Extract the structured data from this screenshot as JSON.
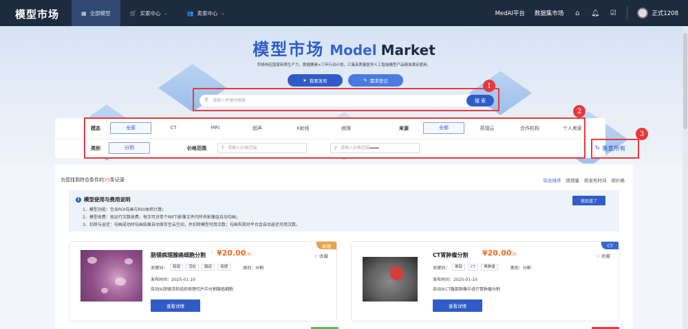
{
  "topbar": {
    "logo": "模型市场",
    "nav": [
      {
        "icon": "grid-icon",
        "label": "全部模型",
        "active": true
      },
      {
        "icon": "cart-icon",
        "label": "买家中心",
        "dropdown": true
      },
      {
        "icon": "user-icon",
        "label": "卖家中心",
        "dropdown": true
      }
    ],
    "links": [
      "MedAI平台",
      "数据集市场"
    ],
    "icons": [
      "home-icon",
      "bell-icon",
      "edit-icon"
    ],
    "username": "正式1208"
  },
  "hero": {
    "title_cn": "模型市场",
    "title_en1": "Model",
    "title_en2": "Market",
    "subtitle": "积极响应国家新质生产力、数据要素×三年行动计划，汇集高质量医学人工智能模型产品精准满足使用。",
    "publish_btn": "我要发布",
    "demand_btn": "需求登记"
  },
  "search": {
    "placeholder": "请输入关键词搜索",
    "button": "搜 索"
  },
  "annotations": [
    "1",
    "2",
    "3"
  ],
  "filters": {
    "modality_label": "模态",
    "modality_options": [
      "全部",
      "CT",
      "MRI",
      "超声",
      "X射线",
      "病理"
    ],
    "modality_selected": "全部",
    "source_label": "来源",
    "source_options": [
      "全部",
      "英瑞云",
      "合作机构",
      "个人卖家"
    ],
    "category_label": "类别",
    "category_selected": "分割",
    "price_label": "价格范围",
    "price_min_placeholder": "请输入价格范围",
    "price_max_placeholder": "请输入价格范围",
    "reset": "重置所有"
  },
  "results": {
    "prefix": "为您找到符合条件的",
    "count": "35",
    "suffix": "条记录",
    "sorts": [
      "综合排序",
      "按销量",
      "按发布时间",
      "按价格"
    ],
    "sort_active": "综合排序"
  },
  "notice": {
    "title": "模型使用与费用说明",
    "lines": [
      "1、模型功能：包含ROI勾画与ROI体积计算；",
      "2、模型收费：按运行次数收费，每次可对单个NIFTI影像文件内所有影像层自动勾画；",
      "3、扣除与返还：勾画成功时勾画结果自动保存至云空间，并扣除模型可用次数；勾画失败时平台会自动返还可用次数。"
    ],
    "button": "我知道了"
  },
  "cards": [
    {
      "tag": "病理",
      "title": "肠镜病理腺癌细胞分割",
      "price": "¥20.00",
      "unit": "/次",
      "fav": "收藏",
      "kw_label": "关键词：",
      "keywords": [
        "肠镜",
        "活检",
        "腺癌",
        "病理"
      ],
      "category": "类别：分割",
      "date": "发布时间：2025-01-10",
      "desc": "自动从肠镜活检组织病理切片中分割腺癌细胞",
      "button": "查看详情"
    },
    {
      "tag": "CT",
      "title": "CT胃肿瘤分割",
      "price": "¥20.00",
      "unit": "/次",
      "fav": "收藏",
      "kw_label": "关键词：",
      "keywords": [
        "胃部",
        "CT",
        "胃肿瘤"
      ],
      "category": "类别：分割",
      "date": "发布时间：2025-01-10",
      "desc": "自动从CT腹部图像中进行胃肿瘤分割",
      "button": "查看详情"
    }
  ],
  "colors": {
    "primary": "#2f5cc7",
    "topbar": "#1e2a3e",
    "annotation": "#e8383d",
    "price": "#ef6a1f"
  }
}
